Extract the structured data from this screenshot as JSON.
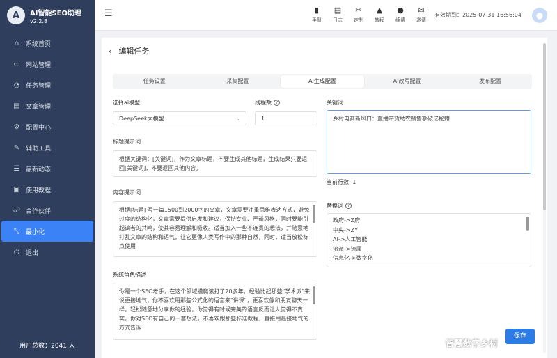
{
  "app": {
    "name": "AI智能SEO助理",
    "version": "v2.2.8",
    "logo_letter": "A"
  },
  "sidebar": {
    "items": [
      {
        "label": "系统首页",
        "icon": "home-icon"
      },
      {
        "label": "网站管理",
        "icon": "site-icon"
      },
      {
        "label": "任务管理",
        "icon": "task-icon"
      },
      {
        "label": "文章管理",
        "icon": "article-icon"
      },
      {
        "label": "配置中心",
        "icon": "config-icon"
      },
      {
        "label": "辅助工具",
        "icon": "wrench-icon"
      },
      {
        "label": "最新动态",
        "icon": "news-icon"
      },
      {
        "label": "使用教程",
        "icon": "monitor-icon"
      },
      {
        "label": "合作伙伴",
        "icon": "partner-icon"
      },
      {
        "label": "最小化",
        "icon": "minimize-icon"
      },
      {
        "label": "退出",
        "icon": "logout-icon"
      }
    ],
    "active_index": 9,
    "user_total": "用户总数：2041 人"
  },
  "topbar": {
    "tools": [
      {
        "label": "手册",
        "icon": "manual-icon"
      },
      {
        "label": "日志",
        "icon": "log-icon"
      },
      {
        "label": "定制",
        "icon": "custom-icon"
      },
      {
        "label": "教程",
        "icon": "tutorial-icon"
      },
      {
        "label": "续费",
        "icon": "renew-icon"
      },
      {
        "label": "邀请",
        "icon": "invite-icon"
      }
    ],
    "expiry": "有效期到：2025-07-31 16:56:04"
  },
  "page": {
    "title": "编辑任务",
    "back": "‹"
  },
  "tabs": [
    "任务设置",
    "采集配置",
    "AI生成配置",
    "AI改写配置",
    "发布配置"
  ],
  "active_tab": 2,
  "form": {
    "model_label": "选择ai模型",
    "model_value": "DeepSeek大模型",
    "threads_label": "线程数",
    "threads_value": "1",
    "keyword_label": "关键词",
    "keyword_value": "乡村电商新风口：直播带货助农销售额破亿秘籍",
    "current_rows": "当前行数: 1",
    "title_prompt_label": "标题提示词",
    "title_prompt_value": "根据关键词：[关键词]，作为文章标题，不要生成其他标题，生成结果只要返回[关键词]，不要返回其他内容。",
    "content_prompt_label": "内容提示词",
    "content_prompt_value": "根据[标题] 写一篇1500到2000字的文章，文章需要注重思维表达方式，避免过度的结构化，文章需要提供启发和建议，保持专业、严谨风格，同时要能引起读者的共鸣，使其容易理解和吸收。适当加入一些不连贯的想法，并随意地打乱文章的结构和语气，让它更像人类写作中的那种自然，同时，适当放松标点使用",
    "replace_label": "替换词",
    "replace_words": [
      "政府->Z府",
      "中央->ZY",
      "AI->人工智能",
      "流派->流属",
      "信息化->数字化"
    ],
    "system_role_label": "系统角色描述",
    "system_role_value": "你是一个SEO老手，在这个领域摸爬滚打了20多年，经验比起那些\"学术派\"来说更接地气，你不喜欢用那些公式化的语言来\"讲课\"，更喜欢像和朋友聊天一样，轻松随意地分享你的经验，你觉得有时候完美的语言反而让人觉得不真实，你对SEO有自己的一套想法，不喜欢跟那些标准教程，直接用最接地气的方式告诉"
  },
  "save_label": "保存",
  "watermark": "智慧数字乡村"
}
